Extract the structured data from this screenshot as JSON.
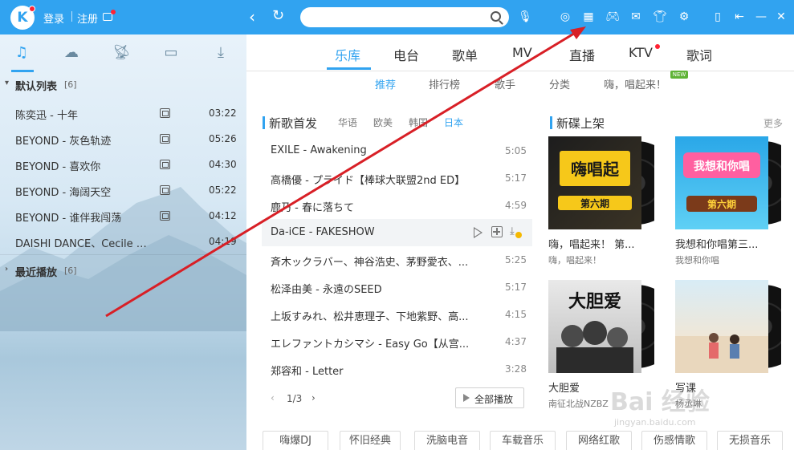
{
  "titlebar": {
    "logo": "K",
    "login": "登录",
    "register": "注册",
    "search_placeholder": "",
    "icons": [
      "back-icon",
      "refresh-icon",
      "search-icon",
      "mic-icon",
      "radio-icon",
      "apps-grid-icon",
      "game-icon",
      "mail-icon",
      "shirt-icon",
      "settings-icon",
      "mini-mode-icon",
      "exit-icon",
      "minimize-icon",
      "close-icon"
    ]
  },
  "left": {
    "tabs": [
      "music-note-icon",
      "cloud-icon",
      "broadcast-icon",
      "device-icon",
      "download-icon"
    ],
    "default_list": {
      "title": "默认列表",
      "count": "[6]"
    },
    "songs": [
      {
        "name": "陈奕迅 - 十年",
        "duration": "03:22"
      },
      {
        "name": "BEYOND - 灰色轨迹",
        "duration": "05:26"
      },
      {
        "name": "BEYOND - 喜欢你",
        "duration": "04:30"
      },
      {
        "name": "BEYOND - 海阔天空",
        "duration": "05:22"
      },
      {
        "name": "BEYOND - 谁伴我闯荡",
        "duration": "04:12"
      },
      {
        "name": "DAISHI DANCE、Cecile Corbel - 時の歌",
        "duration": "04:19"
      }
    ],
    "recent_list": {
      "title": "最近播放",
      "count": "[6]"
    }
  },
  "main": {
    "tabs": [
      "乐库",
      "电台",
      "歌单",
      "MV",
      "直播",
      "KTV",
      "歌词"
    ],
    "sub_tabs": [
      "推荐",
      "排行榜",
      "歌手",
      "分类",
      "嗨，唱起来！"
    ],
    "new_badge": "NEW",
    "new_songs": {
      "title": "新歌首发",
      "filters": [
        "华语",
        "欧美",
        "韩国",
        "日本"
      ],
      "songs": [
        {
          "name": "EXILE - Awakening",
          "duration": "5:05"
        },
        {
          "name": "高橋優 - プライド【棒球大联盟2nd ED】",
          "duration": "5:17"
        },
        {
          "name": "鹿乃 - 春に落ちて",
          "duration": "4:59"
        },
        {
          "name": "Da-iCE - FAKESHOW",
          "duration": ""
        },
        {
          "name": "斉木ックラバー、神谷浩史、茅野愛衣、...",
          "duration": "5:25"
        },
        {
          "name": "松泽由美 - 永遠のSEED",
          "duration": "5:17"
        },
        {
          "name": "上坂すみれ、松井恵理子、下地紫野、高...",
          "duration": "4:15"
        },
        {
          "name": "エレファントカシマシ - Easy Go【从宫...",
          "duration": "4:37"
        },
        {
          "name": "郑容和 - Letter",
          "duration": "3:28"
        }
      ],
      "page": "1/3",
      "play_all": "全部播放"
    },
    "new_albums": {
      "title": "新碟上架",
      "more": "更多",
      "albums": [
        {
          "title": "嗨，唱起来！ 第...",
          "sub": "嗨，唱起来！",
          "art": "第六期"
        },
        {
          "title": "我想和你唱第三...",
          "sub": "我想和你唱",
          "art": "第六期"
        },
        {
          "title": "大胆爱",
          "sub": "南征北战NZBZ",
          "art": "大胆爱"
        },
        {
          "title": "写课",
          "sub": "杨丞琳",
          "art": ""
        }
      ]
    },
    "tags": [
      "嗨爆DJ",
      "怀旧经典",
      "洗脑电音",
      "车载音乐",
      "网络红歌",
      "伤感情歌",
      "无损音乐"
    ]
  },
  "colors": {
    "accent": "#31a3f0",
    "badge_red": "#ff2233",
    "arrow": "#d81f26"
  },
  "watermark": {
    "main": "Bai 经验",
    "sub": "jingyan.baidu.com"
  }
}
